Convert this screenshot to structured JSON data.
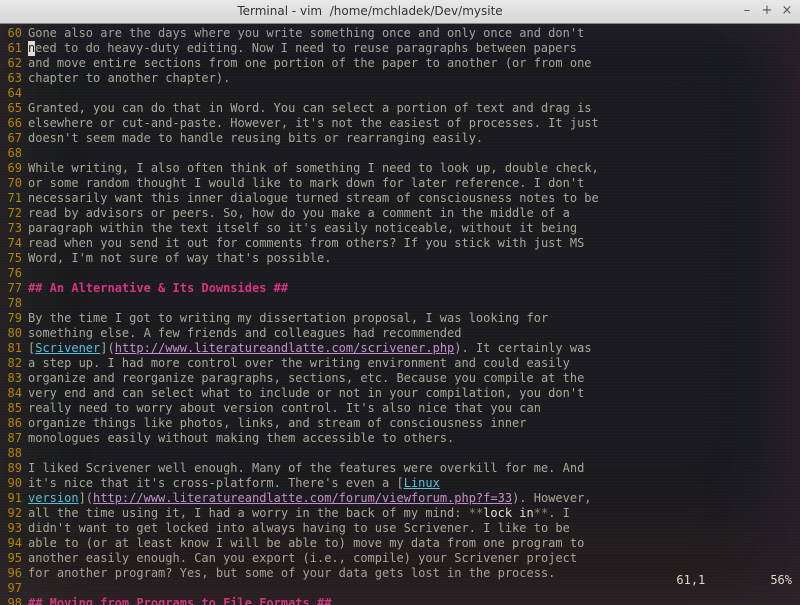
{
  "window": {
    "title": "Terminal - vim  /home/mchladek/Dev/mysite",
    "buttons": {
      "minimize": "–",
      "maximize": "+",
      "close": "×"
    }
  },
  "status": {
    "pos": "61,1",
    "pct": "56%"
  },
  "lines": [
    {
      "n": 60,
      "t": "Gone also are the days where you write something once and only once and don't"
    },
    {
      "n": 61,
      "cursor": true,
      "before": "",
      "after": "eed to do heavy-duty editing. Now I need to reuse paragraphs between papers",
      "cursorChar": "n"
    },
    {
      "n": 62,
      "t": "and move entire sections from one portion of the paper to another (or from one"
    },
    {
      "n": 63,
      "t": "chapter to another chapter)."
    },
    {
      "n": 64,
      "t": ""
    },
    {
      "n": 65,
      "t": "Granted, you can do that in Word. You can select a portion of text and drag is"
    },
    {
      "n": 66,
      "t": "elsewhere or cut-and-paste. However, it's not the easiest of processes. It just"
    },
    {
      "n": 67,
      "t": "doesn't seem made to handle reusing bits or rearranging easily."
    },
    {
      "n": 68,
      "t": ""
    },
    {
      "n": 69,
      "t": "While writing, I also often think of something I need to look up, double check,"
    },
    {
      "n": 70,
      "t": "or some random thought I would like to mark down for later reference. I don't"
    },
    {
      "n": 71,
      "t": "necessarily want this inner dialogue turned stream of consciousness notes to be"
    },
    {
      "n": 72,
      "t": "read by advisors or peers. So, how do you make a comment in the middle of a"
    },
    {
      "n": 73,
      "t": "paragraph within the text itself so it's easily noticeable, without it being"
    },
    {
      "n": 74,
      "t": "read when you send it out for comments from others? If you stick with just MS"
    },
    {
      "n": 75,
      "t": "Word, I'm not sure of way that's possible."
    },
    {
      "n": 76,
      "t": ""
    },
    {
      "n": 77,
      "hdr": true,
      "t": "## An Alternative & Its Downsides ##"
    },
    {
      "n": 78,
      "t": ""
    },
    {
      "n": 79,
      "t": "By the time I got to writing my dissertation proposal, I was looking for"
    },
    {
      "n": 80,
      "t": "something else. A few friends and colleagues had recommended"
    },
    {
      "n": 81,
      "link1": {
        "pre": "[",
        "label": "Scrivener",
        "mid": "](",
        "url": "http://www.literatureandlatte.com/scrivener.php",
        "post": "). It certainly was"
      }
    },
    {
      "n": 82,
      "t": "a step up. I had more control over the writing environment and could easily"
    },
    {
      "n": 83,
      "t": "organize and reorganize paragraphs, sections, etc. Because you compile at the"
    },
    {
      "n": 84,
      "t": "very end and can select what to include or not in your compilation, you don't"
    },
    {
      "n": 85,
      "t": "really need to worry about version control. It's also nice that you can"
    },
    {
      "n": 86,
      "t": "organize things like photos, links, and stream of consciousness inner"
    },
    {
      "n": 87,
      "t": "monologues easily without making them accessible to others."
    },
    {
      "n": 88,
      "t": ""
    },
    {
      "n": 89,
      "t": "I liked Scrivener well enough. Many of the features were overkill for me. And"
    },
    {
      "n": 90,
      "link2a": {
        "pre": "it's nice that it's cross-platform. There's even a [",
        "label": "Linux"
      }
    },
    {
      "n": 91,
      "link2b": {
        "label": "version",
        "mid": "](",
        "url": "http://www.literatureandlatte.com/forum/viewforum.php?f=33",
        "post": "). However,"
      }
    },
    {
      "n": 92,
      "bold1": {
        "pre": "all the time using it, I had a worry in the back of my mind: ",
        "stars": "**",
        "word": "lock in",
        "stars2": "**",
        "post": ". I"
      }
    },
    {
      "n": 93,
      "t": "didn't want to get locked into always having to use Scrivener. I like to be"
    },
    {
      "n": 94,
      "t": "able to (or at least know I will be able to) move my data from one program to"
    },
    {
      "n": 95,
      "t": "another easily enough. Can you export (i.e., compile) your Scrivener project"
    },
    {
      "n": 96,
      "t": "for another program? Yes, but some of your data gets lost in the process."
    },
    {
      "n": 97,
      "t": ""
    },
    {
      "n": 98,
      "hdr": true,
      "t": "## Moving from Programs to File Formats ##"
    }
  ]
}
